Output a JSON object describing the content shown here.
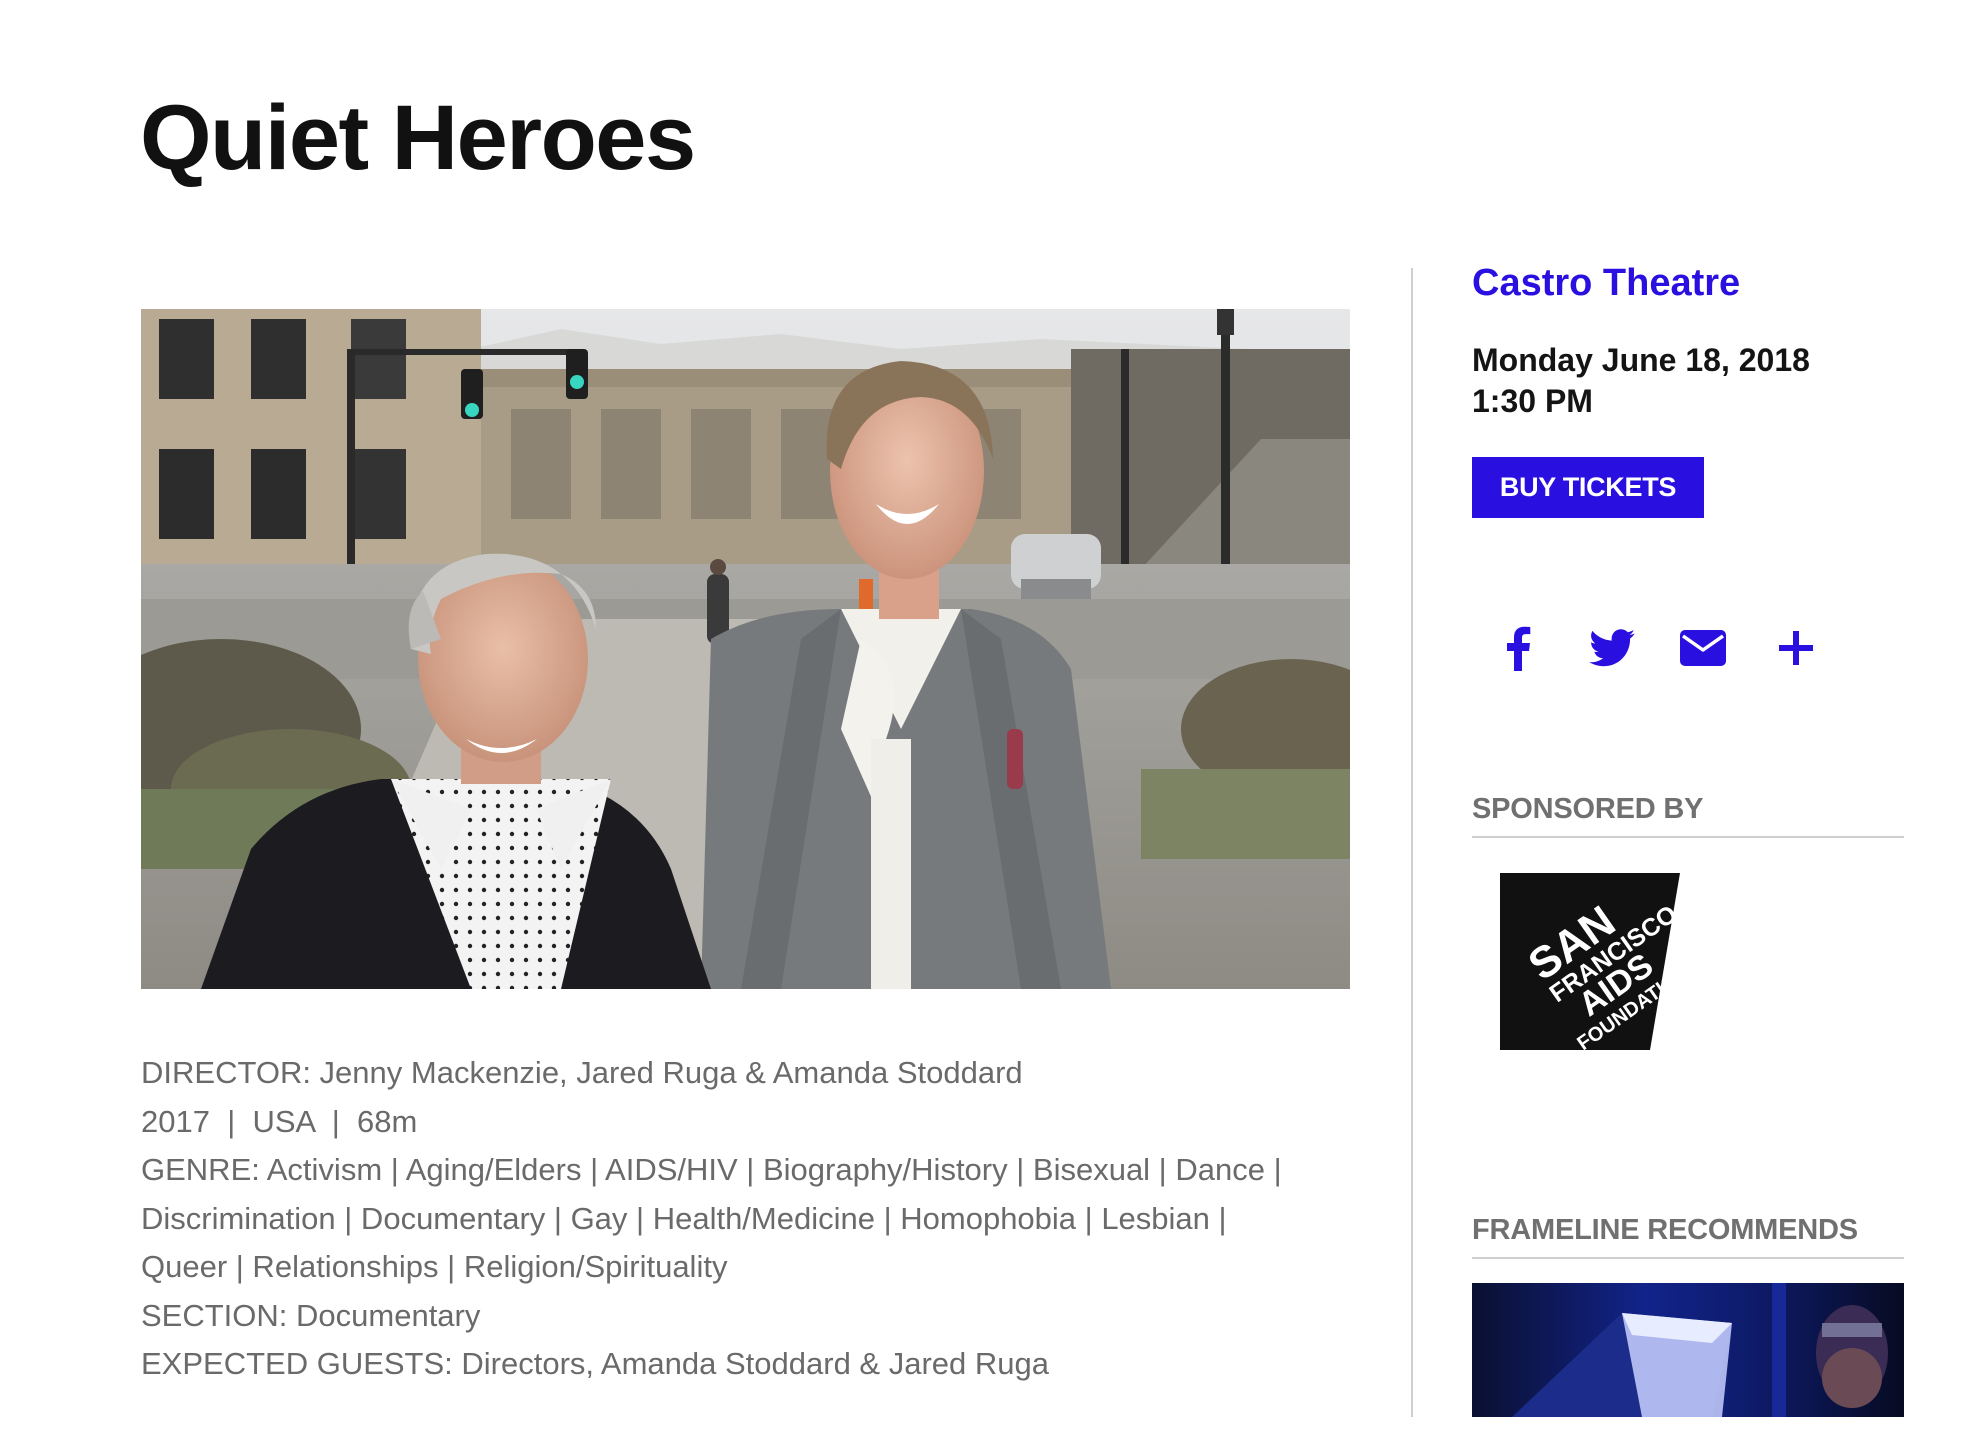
{
  "film": {
    "title": "Quiet Heroes",
    "director_line": "DIRECTOR: Jenny Mackenzie, Jared Ruga & Amanda Stoddard",
    "facts_line": "2017  |  USA  |  68m",
    "genre_lines": [
      "GENRE: Activism | Aging/Elders | AIDS/HIV | Biography/History | Bisexual | Dance |",
      "Discrimination | Documentary | Gay | Health/Medicine | Homophobia | Lesbian |",
      "Queer | Relationships | Religion/Spirituality"
    ],
    "section_line": "SECTION: Documentary",
    "guests_line": "EXPECTED GUESTS: Directors, Amanda Stoddard & Jared Ruga"
  },
  "screening": {
    "venue": "Castro Theatre",
    "date": "Monday June 18, 2018",
    "time": "1:30 PM",
    "buy_label": "BUY TICKETS"
  },
  "share": {
    "icons": [
      "facebook-icon",
      "twitter-icon",
      "email-icon",
      "plus-icon"
    ],
    "color": "#2a10e0"
  },
  "sponsor": {
    "heading": "SPONSORED BY",
    "logo_text": [
      "SAN",
      "FRANCISCO",
      "AIDS",
      "FOUNDATION"
    ]
  },
  "recommends": {
    "heading": "FRAMELINE RECOMMENDS"
  },
  "colors": {
    "accent": "#2a10e0",
    "heading": "#111111",
    "meta_text": "#6a6a6a",
    "divider": "#cfcfcf"
  }
}
